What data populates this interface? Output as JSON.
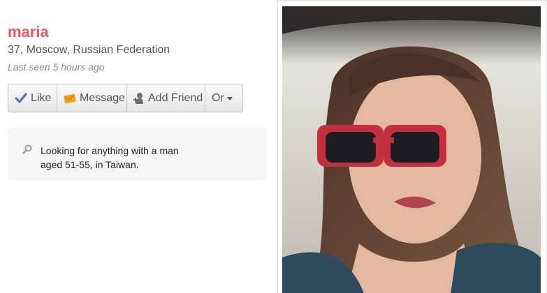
{
  "profile": {
    "name": "maria",
    "location": "37, Moscow, Russian Federation",
    "last_seen": "Last seen 5 hours ago"
  },
  "actions": {
    "like_label": "Like",
    "message_label": "Message",
    "add_friend_label": "Add Friend",
    "or_label": "Or"
  },
  "looking_for": {
    "text": "Looking for anything with a man aged 51-55, in Taiwan."
  },
  "colors": {
    "name": "#e8595b",
    "like_icon": "#3b6fd1",
    "message_icon": "#f0a01e"
  },
  "icons": {
    "like": "checkmark-icon",
    "message": "envelope-icon",
    "add_friend": "person-icon",
    "or": "chevron-down-icon",
    "looking": "search-icon"
  }
}
